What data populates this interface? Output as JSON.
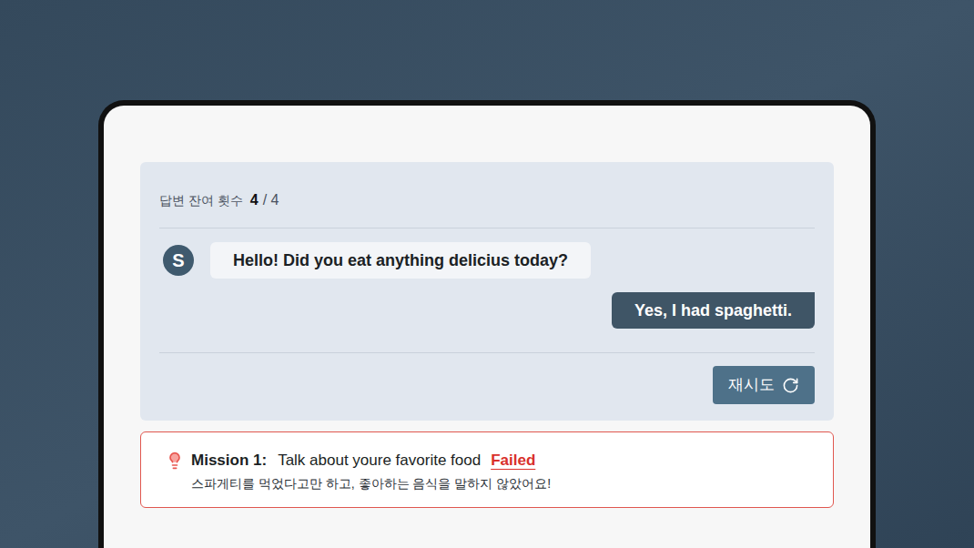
{
  "chat": {
    "remaining_label": "답변 잔여 횟수",
    "remaining": "4",
    "total": "/ 4",
    "messages": [
      {
        "sender": "bot",
        "avatar": "S",
        "text": "Hello! Did you eat anything delicius today?"
      },
      {
        "sender": "user",
        "text": "Yes, I had spaghetti."
      }
    ],
    "retry_button": "재시도"
  },
  "mission": {
    "label": "Mission 1:",
    "title": "Talk about youre favorite food",
    "status": "Failed",
    "passed": false,
    "feedback": "스파게티를 먹었다고만 하고, 좋아하는 음식을 말하지 않았어요!"
  }
}
